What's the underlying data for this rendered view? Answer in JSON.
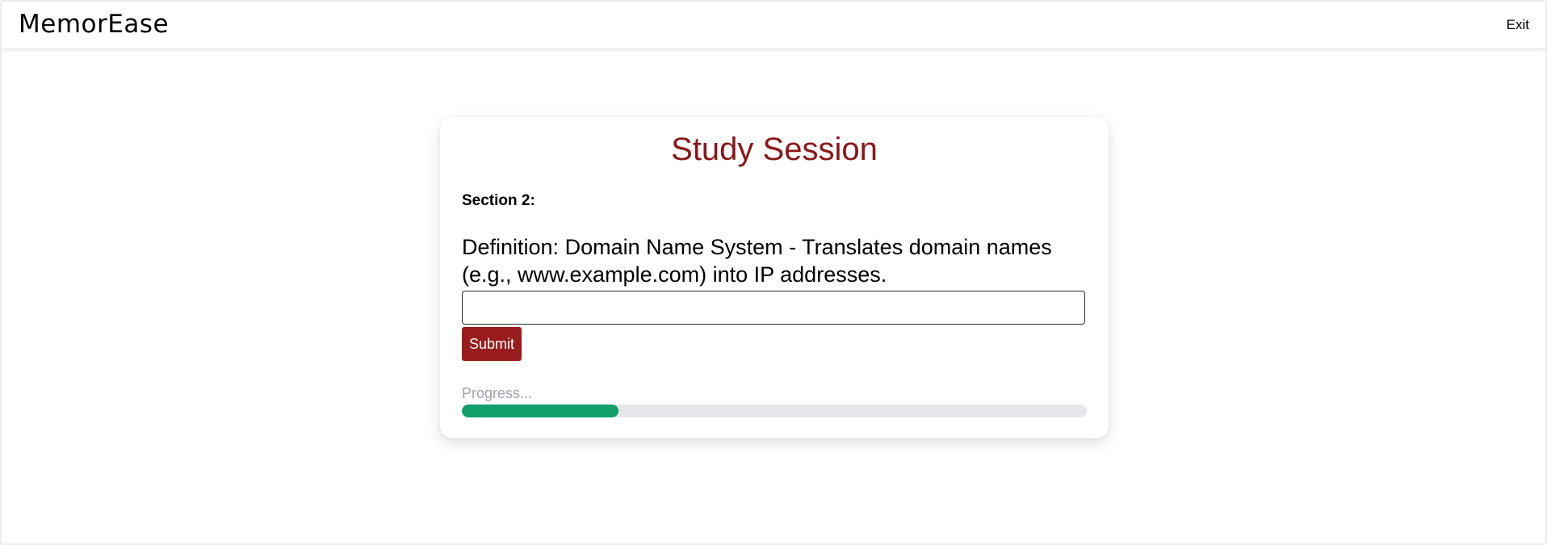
{
  "header": {
    "brand": "MemorEase",
    "exit_label": "Exit"
  },
  "session": {
    "title": "Study Session",
    "section_label": "Section 2:",
    "definition": "Definition: Domain Name System - Translates domain names (e.g., www.example.com) into IP addresses.",
    "answer_value": "",
    "answer_placeholder": "",
    "submit_label": "Submit",
    "progress_label": "Progress...",
    "progress_fraction": 0.25
  },
  "colors": {
    "title": "#8b1616",
    "submit_bg": "#9a1b1b",
    "progress_fill": "#12a06a",
    "progress_track": "#e6e7eb"
  }
}
